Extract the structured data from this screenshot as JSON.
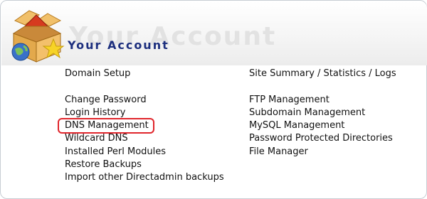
{
  "header": {
    "title": "Your Account",
    "watermark": "Your Account"
  },
  "left_column": {
    "section_link": "Domain Setup",
    "items": [
      "Change Password",
      "Login History",
      "DNS Management",
      "Wildcard DNS",
      "Installed Perl Modules",
      "Restore Backups",
      "Import other Directadmin backups"
    ]
  },
  "right_column": {
    "section_link": "Site Summary / Statistics / Logs",
    "items": [
      "FTP Management",
      "Subdomain Management",
      "MySQL Management",
      "Password Protected Directories",
      "File Manager"
    ]
  },
  "highlighted_item": "DNS Management",
  "colors": {
    "title": "#1d2f7e",
    "highlight": "#e0252b",
    "text": "#111111"
  },
  "icon": "account-box-house-globe-star-icon"
}
